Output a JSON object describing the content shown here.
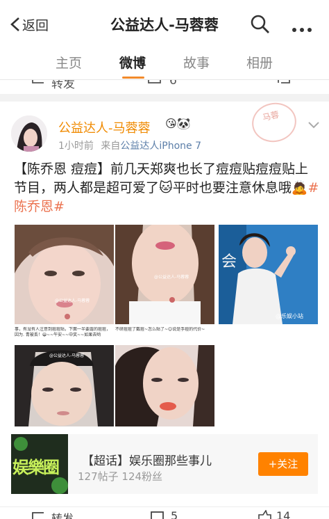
{
  "header": {
    "back_label": "返回",
    "title": "公益达人-马蓉蓉"
  },
  "tabs": [
    {
      "label": "主页"
    },
    {
      "label": "微博"
    },
    {
      "label": "故事"
    },
    {
      "label": "相册"
    }
  ],
  "prev_post": {
    "repost_label": "转发",
    "comment_count": "6"
  },
  "post": {
    "stamp_text": "马蓉",
    "author": "公益达人-马蓉蓉",
    "badges": "😘🐼",
    "time": "1小时前",
    "source_prefix": "来自",
    "source": "公益达人iPhone 7",
    "text_tag1": "【陈乔恩 痘痘】",
    "text_main": "前几天郑爽也长了痘痘贴痘痘贴上节目，两人都是超可爱了",
    "emoji1": "🐱",
    "text_main2": "平时也要注意休息哦",
    "emoji2": "🙇",
    "hashtag": "#陈乔恩#",
    "photos": [
      {
        "caption": "@公益达人-马蓉蓉"
      },
      {
        "caption": "@公益达人-马蓉蓉"
      },
      {
        "caption": "@乐娱小站"
      },
      {
        "caption": "事，有没有人注意到痘痘贴，下面一半要露的痘痘，因为. 青被丢！😁~~午安~~中奖~~如果去哟"
      },
      {
        "caption": "不研痘痘了戴痘~怎么贴了~😊说是手痘的代价~"
      }
    ],
    "photo4_watermark": "@公益达人-马蓉蓉"
  },
  "super_topic": {
    "logo_text": "娱樂圈",
    "title": "【超话】娱乐圈那些事儿",
    "stats": "127帖子 124粉丝",
    "follow_label": "+关注"
  },
  "action_bar": {
    "repost_label": "转发",
    "comment_count": "5",
    "like_count": "14"
  },
  "colors": {
    "accent": "#f28a2b",
    "username": "#f08a00",
    "tag": "#eb7350",
    "follow": "#ff8200"
  }
}
